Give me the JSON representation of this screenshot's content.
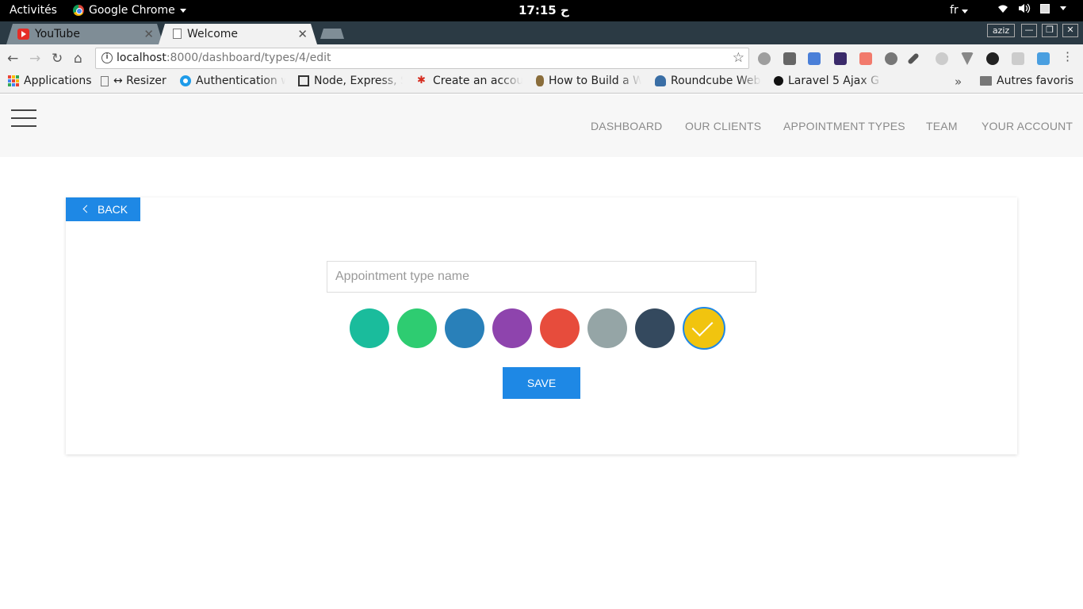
{
  "os_topbar": {
    "activities": "Activités",
    "app_name": "Google Chrome",
    "clock": "17:15 ح",
    "input_lang": "fr"
  },
  "browser": {
    "tabs": [
      {
        "label": "YouTube",
        "icon": "youtube-icon",
        "active": false
      },
      {
        "label": "Welcome",
        "icon": "page-icon",
        "active": true
      }
    ],
    "profile_user": "aziz",
    "url_host": "localhost",
    "url_rest": ":8000/dashboard/types/4/edit",
    "bookmarks": [
      {
        "label": "Applications",
        "icon": "apps-icon"
      },
      {
        "label": "↔ Resizer",
        "icon": "page-icon"
      },
      {
        "label": "Authentication wi",
        "icon": "auth-icon"
      },
      {
        "label": "Node, Express, S",
        "icon": "node-icon"
      },
      {
        "label": "Create an accoun",
        "icon": "maple-leaf-icon"
      },
      {
        "label": "How to Build a W",
        "icon": "lemur-icon"
      },
      {
        "label": "Roundcube Webm",
        "icon": "roundcube-icon"
      },
      {
        "label": "Laravel 5 Ajax G",
        "icon": "play-icon"
      }
    ],
    "other_bookmarks": "Autres favoris"
  },
  "app": {
    "nav": [
      "DASHBOARD",
      "OUR CLIENTS",
      "APPOINTMENT TYPES",
      "TEAM",
      "YOUR ACCOUNT"
    ],
    "back_label": "BACK",
    "name_placeholder": "Appointment type name",
    "name_value": "",
    "save_label": "SAVE",
    "colors": [
      "#1abc9c",
      "#2ecc71",
      "#2980b9",
      "#8e44ad",
      "#e74c3c",
      "#95a5a6",
      "#34495e",
      "#f1c40f"
    ],
    "selected_color": "#f1c40f"
  },
  "accent_color": "#1e88e5"
}
